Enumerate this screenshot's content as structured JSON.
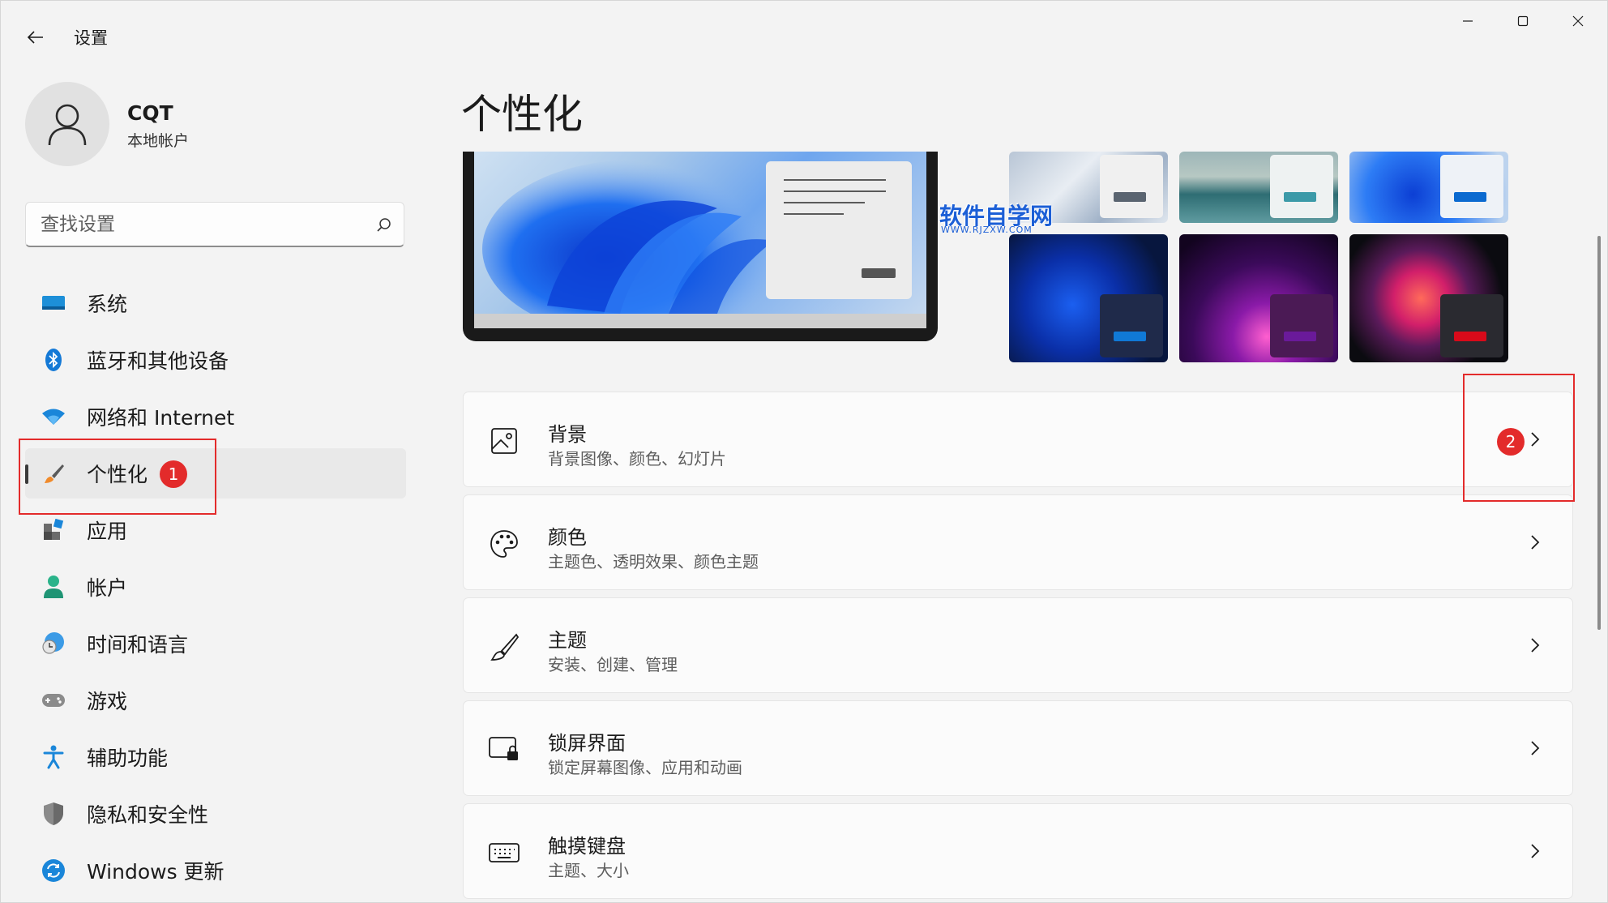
{
  "app": {
    "title": "设置"
  },
  "window_controls": {
    "minimize": "minimize-icon",
    "maximize": "maximize-icon",
    "close": "close-icon"
  },
  "profile": {
    "name": "CQT",
    "account_type": "本地帐户"
  },
  "search": {
    "placeholder": "查找设置"
  },
  "sidebar": {
    "items": [
      {
        "label": "系统",
        "icon": "system-icon"
      },
      {
        "label": "蓝牙和其他设备",
        "icon": "bluetooth-icon"
      },
      {
        "label": "网络和 Internet",
        "icon": "wifi-icon"
      },
      {
        "label": "个性化",
        "icon": "brush-icon",
        "selected": true
      },
      {
        "label": "应用",
        "icon": "apps-icon"
      },
      {
        "label": "帐户",
        "icon": "account-icon"
      },
      {
        "label": "时间和语言",
        "icon": "time-language-icon"
      },
      {
        "label": "游戏",
        "icon": "gamepad-icon"
      },
      {
        "label": "辅助功能",
        "icon": "accessibility-icon"
      },
      {
        "label": "隐私和安全性",
        "icon": "shield-icon"
      },
      {
        "label": "Windows 更新",
        "icon": "update-icon"
      }
    ]
  },
  "annotations": {
    "step1": "1",
    "step2": "2",
    "highlight_color": "#e32b2b"
  },
  "main": {
    "title": "个性化",
    "watermark": {
      "text": "软件自学网",
      "sub": "WWW.RJZXW.COM"
    },
    "cards": [
      {
        "title": "背景",
        "subtitle": "背景图像、颜色、幻灯片",
        "icon": "image-icon"
      },
      {
        "title": "颜色",
        "subtitle": "主题色、透明效果、颜色主题",
        "icon": "palette-icon"
      },
      {
        "title": "主题",
        "subtitle": "安装、创建、管理",
        "icon": "brush-icon"
      },
      {
        "title": "锁屏界面",
        "subtitle": "锁定屏幕图像、应用和动画",
        "icon": "lock-screen-icon"
      },
      {
        "title": "触摸键盘",
        "subtitle": "主题、大小",
        "icon": "keyboard-icon"
      }
    ]
  },
  "colors": {
    "accent": "#0067c0",
    "window_bg": "#f3f3f3",
    "card_bg": "#fbfbfb"
  }
}
